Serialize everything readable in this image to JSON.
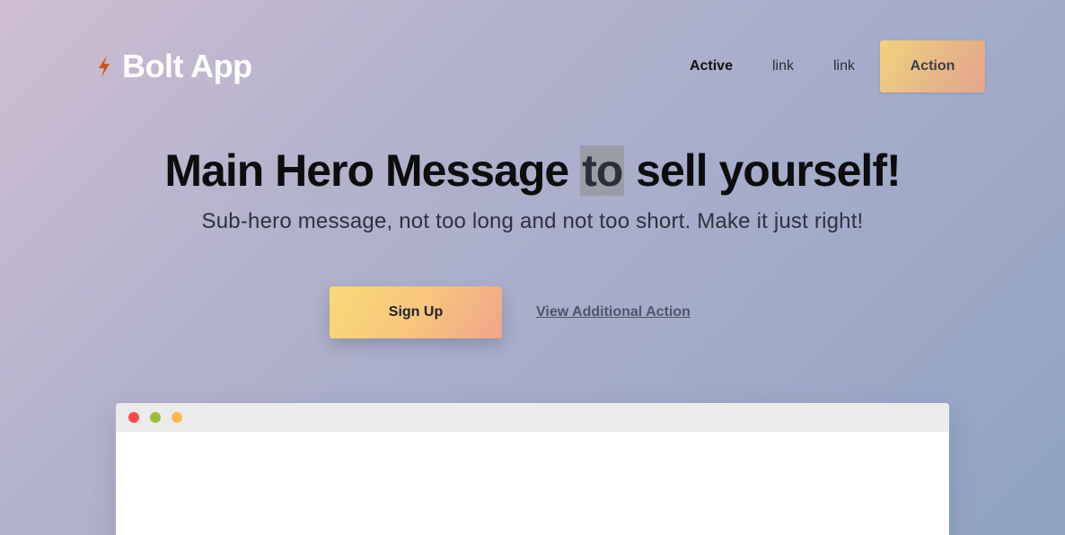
{
  "brand": {
    "name": "Bolt App",
    "icon": "bolt-icon",
    "icon_color": "#c8551a"
  },
  "nav": {
    "links": [
      {
        "label": "Active",
        "active": true
      },
      {
        "label": "link",
        "active": false
      },
      {
        "label": "link",
        "active": false
      }
    ],
    "action_label": "Action"
  },
  "hero": {
    "title_before": "Main Hero Message ",
    "title_highlight": "to",
    "title_after": " sell yourself!",
    "subtitle": "Sub-hero message, not too long and not too short. Make it just right!"
  },
  "cta": {
    "primary_label": "Sign Up",
    "secondary_label": "View Additional Action"
  },
  "browser_mockup": {
    "dots": [
      {
        "name": "close",
        "color": "#fc4a4a"
      },
      {
        "name": "minimize",
        "color": "#9ebd3c"
      },
      {
        "name": "maximize",
        "color": "#fdb94e"
      }
    ]
  }
}
